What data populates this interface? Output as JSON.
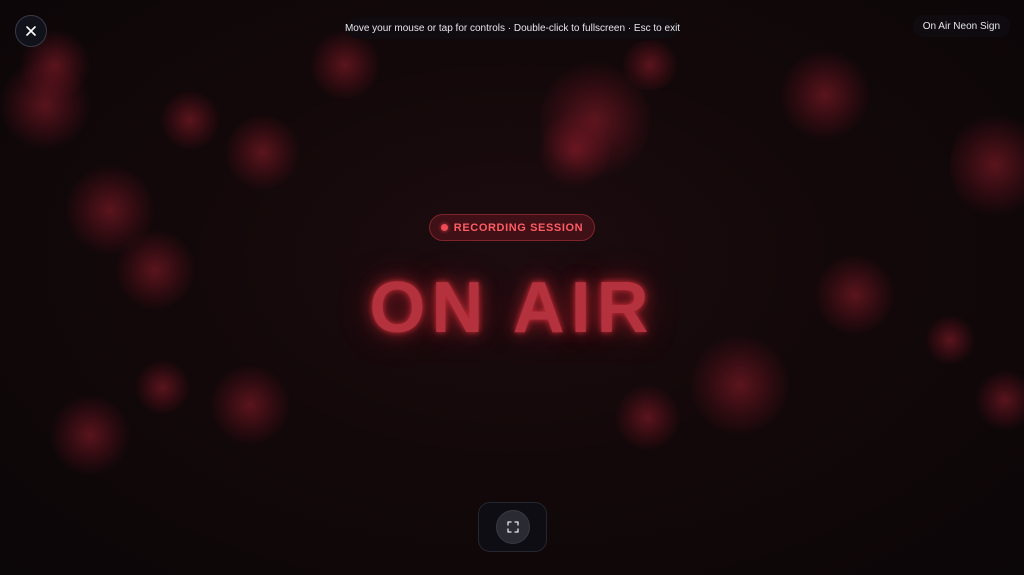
{
  "window": {
    "title": "On Air Neon Sign"
  },
  "header": {
    "close_icon": "close-icon",
    "hint": "Move your mouse or tap for controls · Double-click to fullscreen · Esc to exit"
  },
  "sign": {
    "badge_label": "RECORDING SESSION",
    "main_text": "ON AIR"
  },
  "controls": {
    "fullscreen_icon": "fullscreen-icon"
  },
  "colors": {
    "background": "#0c0709",
    "neon_red": "#b3323d",
    "badge_text": "#ff5c64",
    "recording_dot": "#f04a55"
  }
}
